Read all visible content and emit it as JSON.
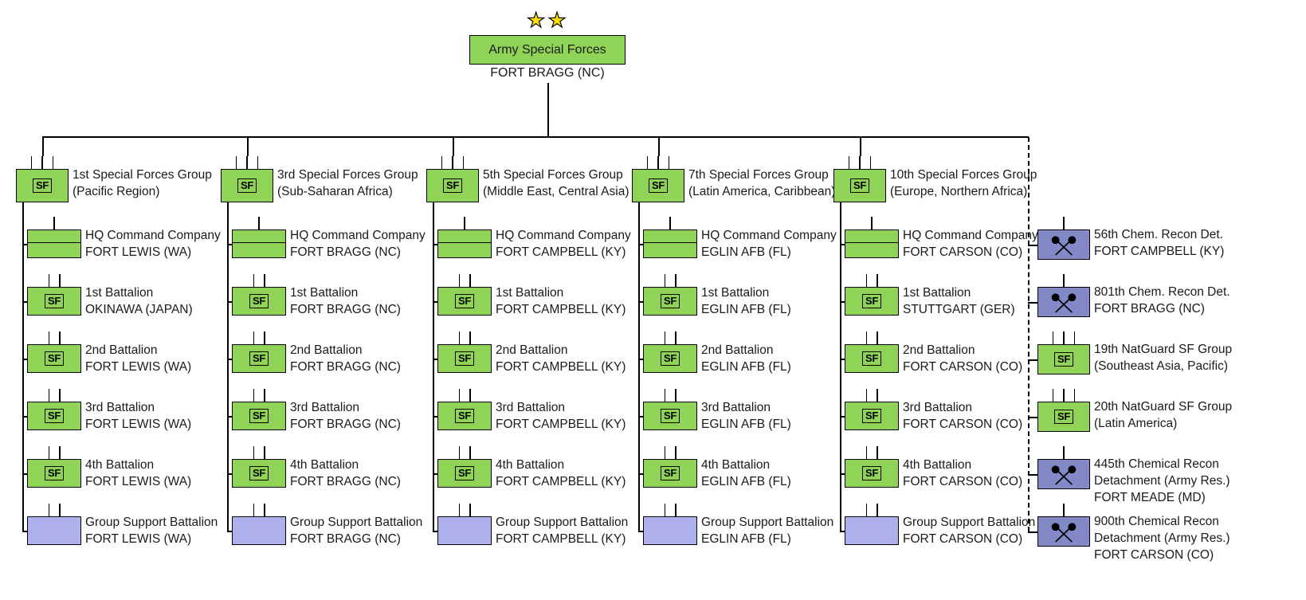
{
  "root": {
    "title": "Army Special Forces",
    "location": "FORT BRAGG (NC)",
    "rank_icon": "two-star-icon",
    "rank_stars": 2,
    "symbol": "SF",
    "colors": {
      "sf_green": "#8FD457",
      "support_purple": "#AEB0EE",
      "chem_purple": "#8289C6"
    }
  },
  "columns": [
    {
      "group": {
        "name": "1st Special Forces Group",
        "region": "(Pacific Region)",
        "symbol": "SF",
        "echelon_ticks": 3
      },
      "units": [
        {
          "name": "HQ Command Company",
          "location": "FORT LEWIS (WA)",
          "type": "hq",
          "echelon_ticks": 1
        },
        {
          "name": "1st Battalion",
          "location": "OKINAWA (JAPAN)",
          "type": "sf",
          "echelon_ticks": 2
        },
        {
          "name": "2nd Battalion",
          "location": "FORT LEWIS (WA)",
          "type": "sf",
          "echelon_ticks": 2
        },
        {
          "name": "3rd Battalion",
          "location": "FORT LEWIS (WA)",
          "type": "sf",
          "echelon_ticks": 2
        },
        {
          "name": "4th Battalion",
          "location": "FORT LEWIS (WA)",
          "type": "sf",
          "echelon_ticks": 2
        },
        {
          "name": "Group Support Battalion",
          "location": "FORT LEWIS (WA)",
          "type": "support",
          "echelon_ticks": 2
        }
      ]
    },
    {
      "group": {
        "name": "3rd Special Forces Group",
        "region": "(Sub-Saharan Africa)",
        "symbol": "SF",
        "echelon_ticks": 3
      },
      "units": [
        {
          "name": "HQ Command Company",
          "location": "FORT BRAGG (NC)",
          "type": "hq",
          "echelon_ticks": 1
        },
        {
          "name": "1st Battalion",
          "location": "FORT BRAGG (NC)",
          "type": "sf",
          "echelon_ticks": 2
        },
        {
          "name": "2nd Battalion",
          "location": "FORT BRAGG (NC)",
          "type": "sf",
          "echelon_ticks": 2
        },
        {
          "name": "3rd Battalion",
          "location": "FORT BRAGG (NC)",
          "type": "sf",
          "echelon_ticks": 2
        },
        {
          "name": "4th Battalion",
          "location": "FORT BRAGG (NC)",
          "type": "sf",
          "echelon_ticks": 2
        },
        {
          "name": "Group Support Battalion",
          "location": "FORT BRAGG (NC)",
          "type": "support",
          "echelon_ticks": 2
        }
      ]
    },
    {
      "group": {
        "name": "5th Special Forces Group",
        "region": "(Middle East, Central Asia)",
        "symbol": "SF",
        "echelon_ticks": 3
      },
      "units": [
        {
          "name": "HQ Command Company",
          "location": "FORT CAMPBELL (KY)",
          "type": "hq",
          "echelon_ticks": 1
        },
        {
          "name": "1st Battalion",
          "location": "FORT CAMPBELL (KY)",
          "type": "sf",
          "echelon_ticks": 2
        },
        {
          "name": "2nd Battalion",
          "location": "FORT CAMPBELL (KY)",
          "type": "sf",
          "echelon_ticks": 2
        },
        {
          "name": "3rd Battalion",
          "location": "FORT CAMPBELL (KY)",
          "type": "sf",
          "echelon_ticks": 2
        },
        {
          "name": "4th Battalion",
          "location": "FORT CAMPBELL (KY)",
          "type": "sf",
          "echelon_ticks": 2
        },
        {
          "name": "Group Support Battalion",
          "location": "FORT CAMPBELL (KY)",
          "type": "support",
          "echelon_ticks": 2
        }
      ]
    },
    {
      "group": {
        "name": "7th Special Forces Group",
        "region": "(Latin America, Caribbean)",
        "symbol": "SF",
        "echelon_ticks": 3
      },
      "units": [
        {
          "name": "HQ Command Company",
          "location": "EGLIN AFB (FL)",
          "type": "hq",
          "echelon_ticks": 1
        },
        {
          "name": "1st Battalion",
          "location": "EGLIN AFB (FL)",
          "type": "sf",
          "echelon_ticks": 2
        },
        {
          "name": "2nd Battalion",
          "location": "EGLIN AFB (FL)",
          "type": "sf",
          "echelon_ticks": 2
        },
        {
          "name": "3rd Battalion",
          "location": "EGLIN AFB (FL)",
          "type": "sf",
          "echelon_ticks": 2
        },
        {
          "name": "4th Battalion",
          "location": "EGLIN AFB (FL)",
          "type": "sf",
          "echelon_ticks": 2
        },
        {
          "name": "Group Support Battalion",
          "location": "EGLIN AFB (FL)",
          "type": "support",
          "echelon_ticks": 2
        }
      ]
    },
    {
      "group": {
        "name": "10th Special Forces Group",
        "region": "(Europe, Northern Africa)",
        "symbol": "SF",
        "echelon_ticks": 3
      },
      "units": [
        {
          "name": "HQ Command Company",
          "location": "FORT CARSON (CO)",
          "type": "hq",
          "echelon_ticks": 1
        },
        {
          "name": "1st Battalion",
          "location": "STUTTGART (GER)",
          "type": "sf",
          "echelon_ticks": 2
        },
        {
          "name": "2nd Battalion",
          "location": "FORT CARSON (CO)",
          "type": "sf",
          "echelon_ticks": 2
        },
        {
          "name": "3rd Battalion",
          "location": "FORT CARSON (CO)",
          "type": "sf",
          "echelon_ticks": 2
        },
        {
          "name": "4th Battalion",
          "location": "FORT CARSON (CO)",
          "type": "sf",
          "echelon_ticks": 2
        },
        {
          "name": "Group Support Battalion",
          "location": "FORT CARSON (CO)",
          "type": "support",
          "echelon_ticks": 2
        }
      ]
    }
  ],
  "attached": {
    "connector": "dashed",
    "units": [
      {
        "line1": "56th Chem. Recon Det.",
        "line2": "FORT CAMPBELL (KY)",
        "line3": "",
        "type": "chem",
        "echelon_ticks": 1
      },
      {
        "line1": "801th Chem. Recon Det.",
        "line2": "FORT BRAGG (NC)",
        "line3": "",
        "type": "chem",
        "echelon_ticks": 1
      },
      {
        "line1": "19th NatGuard SF Group",
        "line2": "(Southeast Asia, Pacific)",
        "line3": "",
        "type": "sf",
        "echelon_ticks": 3
      },
      {
        "line1": "20th NatGuard SF Group",
        "line2": "(Latin America)",
        "line3": "",
        "type": "sf",
        "echelon_ticks": 3
      },
      {
        "line1": "445th Chemical Recon",
        "line2": "Detachment (Army Res.)",
        "line3": "FORT MEADE (MD)",
        "type": "chem",
        "echelon_ticks": 1
      },
      {
        "line1": "900th Chemical Recon",
        "line2": "Detachment (Army Res.)",
        "line3": "FORT CARSON (CO)",
        "type": "chem",
        "echelon_ticks": 1
      }
    ]
  }
}
